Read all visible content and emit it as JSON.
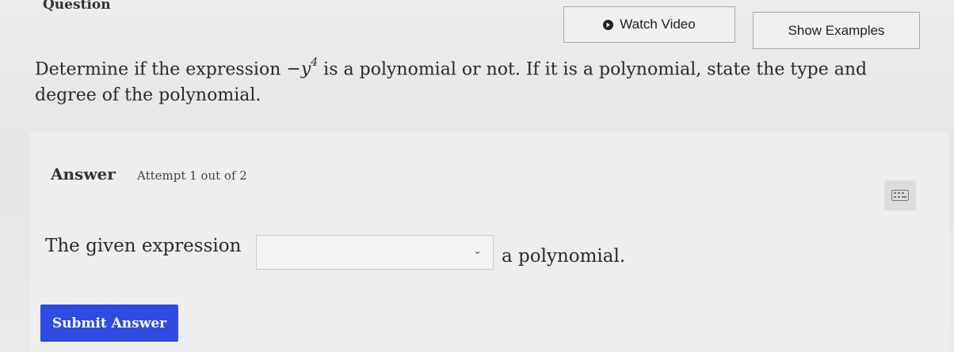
{
  "header": {
    "question_label": "Question",
    "watch_video_label": "Watch Video",
    "show_examples_label": "Show Examples"
  },
  "prompt": {
    "before": "Determine if the expression ",
    "expr_base": "−y",
    "expr_exponent": "4",
    "after": " is a polynomial or not. If it is a polynomial, state the type and degree of the polynomial."
  },
  "answer": {
    "heading": "Answer",
    "attempt": "Attempt 1 out of 2",
    "sentence_before": "The given expression",
    "select_value": "",
    "sentence_after": "a polynomial.",
    "submit_label": "Submit Answer"
  },
  "icons": {
    "video": "play-circle-icon",
    "select": "chevron-down-icon",
    "keypad": "keypad-icon"
  },
  "colors": {
    "submit_bg": "#2f4be0"
  }
}
